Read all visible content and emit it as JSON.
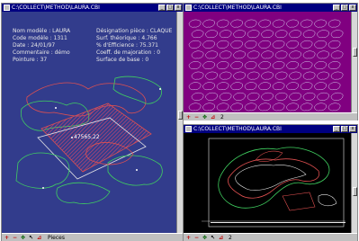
{
  "windows": {
    "left": {
      "title": "C:\\COLLECT\\METHOD\\LAURA.CBI",
      "layout_label": "47565,22",
      "status_label": "Pieces"
    },
    "top_right": {
      "title": "C:\\COLLECT\\METHOD\\LAURA.CBI",
      "status_label": "2"
    },
    "bottom_right": {
      "title": "C:\\COLLECT\\METHOD\\LAURA.CBI",
      "status_label": "2"
    }
  },
  "info": {
    "left_column": [
      {
        "label": "Nom modèle",
        "value": "LAURA"
      },
      {
        "label": "Code modèle",
        "value": "1311"
      },
      {
        "label": "Date",
        "value": "24/01/97"
      },
      {
        "label": "Commentaire",
        "value": "démo"
      },
      {
        "label": "Pointure",
        "value": "37"
      }
    ],
    "right_column": [
      {
        "label": "Désignation pièce",
        "value": "CLAQUE"
      },
      {
        "label": "Surf. théorique",
        "value": "4.766"
      },
      {
        "label": "% d'Efficience",
        "value": "75.371"
      },
      {
        "label": "Coeff. de majoration",
        "value": "0"
      },
      {
        "label": "Surface de base",
        "value": "0"
      }
    ]
  },
  "icons": [
    "system-menu-icon",
    "minimize-icon",
    "maximize-icon",
    "close-icon",
    "zoom-in-icon",
    "zoom-out-icon",
    "pan-icon",
    "select-icon",
    "ruler-icon"
  ],
  "colors": {
    "title_bar": "#000080",
    "left_canvas": "#323c8c",
    "top_right_canvas": "#800080",
    "bottom_right_canvas": "#000000",
    "hatch": "#c8466e"
  }
}
